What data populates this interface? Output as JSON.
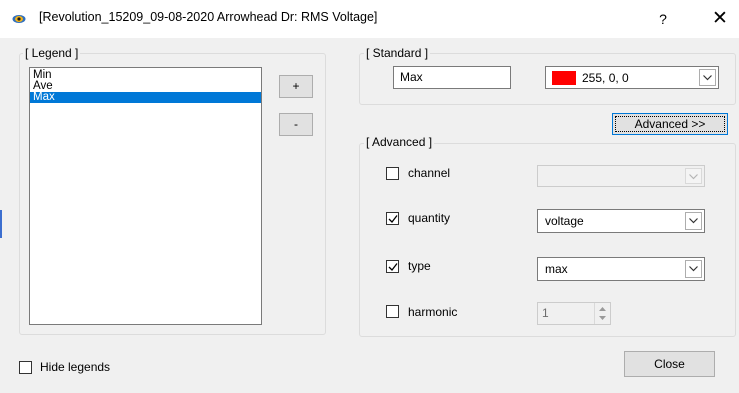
{
  "window": {
    "title": "[Revolution_15209_09-08-2020 Arrowhead Dr: RMS Voltage]",
    "help_label": "?",
    "close_glyph": "✕"
  },
  "legend": {
    "group_label": "[ Legend ]",
    "items": [
      "Min",
      "Ave",
      "Max"
    ],
    "selected": "Max",
    "add_label": "+",
    "remove_label": "-"
  },
  "standard": {
    "group_label": "[ Standard ]",
    "name_value": "Max",
    "color_value": "255, 0, 0",
    "color_hex": "#ff0000"
  },
  "advanced_toggle_label": "Advanced >>",
  "advanced": {
    "group_label": "[ Advanced ]",
    "channel": {
      "label": "channel",
      "checked": false,
      "value": ""
    },
    "quantity": {
      "label": "quantity",
      "checked": true,
      "value": "voltage"
    },
    "type": {
      "label": "type",
      "checked": true,
      "value": "max"
    },
    "harmonic": {
      "label": "harmonic",
      "checked": false,
      "value": "1"
    }
  },
  "footer": {
    "hide_legends_label": "Hide legends",
    "hide_legends_checked": false,
    "close_label": "Close"
  },
  "colors": {
    "selection": "#0078d7",
    "dialog_bg": "#f0f0f0"
  }
}
